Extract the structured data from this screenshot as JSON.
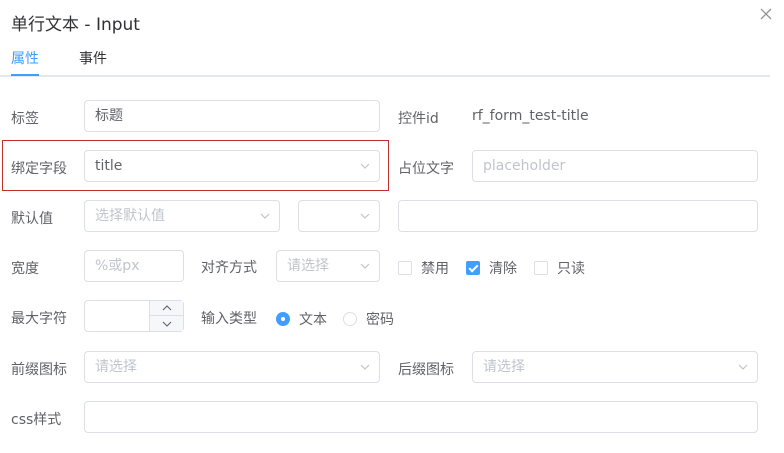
{
  "dialog": {
    "title": "单行文本 - Input"
  },
  "tabs": [
    {
      "label": "属性"
    },
    {
      "label": "事件"
    }
  ],
  "form": {
    "label_field": {
      "label": "标签",
      "value": "标题"
    },
    "control_id": {
      "label": "控件id",
      "value": "rf_form_test-title"
    },
    "bind_field": {
      "label": "绑定字段",
      "value": "title"
    },
    "placeholder_field": {
      "label": "占位文字",
      "placeholder": "placeholder"
    },
    "default_value": {
      "label": "默认值",
      "placeholder": "选择默认值"
    },
    "width_field": {
      "label": "宽度",
      "placeholder": "%或px"
    },
    "align": {
      "label": "对齐方式",
      "placeholder": "请选择"
    },
    "options": [
      {
        "label": "禁用",
        "checked": false
      },
      {
        "label": "清除",
        "checked": true
      },
      {
        "label": "只读",
        "checked": false
      }
    ],
    "max_chars": {
      "label": "最大字符"
    },
    "input_type": {
      "label": "输入类型",
      "options": [
        {
          "label": "文本",
          "selected": true
        },
        {
          "label": "密码",
          "selected": false
        }
      ]
    },
    "prefix_icon": {
      "label": "前缀图标",
      "placeholder": "请选择"
    },
    "suffix_icon": {
      "label": "后缀图标",
      "placeholder": "请选择"
    },
    "css_style": {
      "label": "css样式"
    }
  },
  "colors": {
    "accent": "#409eff",
    "highlight_border": "#c0302a"
  }
}
